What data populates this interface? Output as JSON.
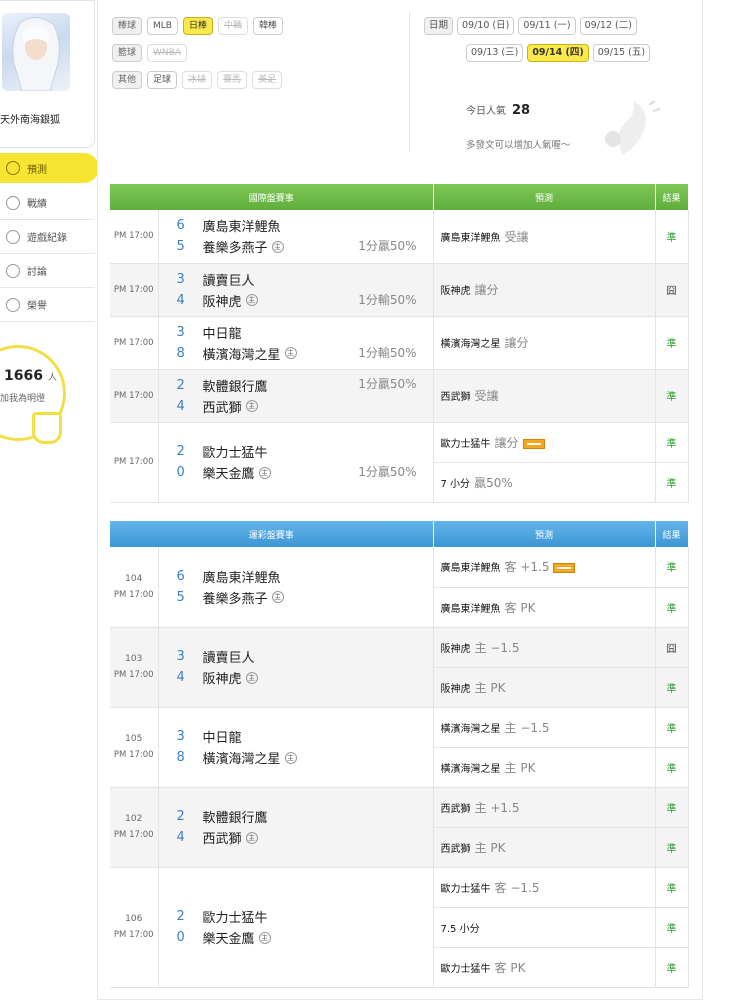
{
  "user": {
    "name": "天外南海銀狐"
  },
  "nav": [
    {
      "label": "預測",
      "icon": "target-icon",
      "active": true
    },
    {
      "label": "戰績",
      "icon": "chat-icon",
      "active": false
    },
    {
      "label": "遊戲紀錄",
      "icon": "circle-icon",
      "active": false
    },
    {
      "label": "討論",
      "icon": "edit-icon",
      "active": false
    },
    {
      "label": "榮譽",
      "icon": "medal-icon",
      "active": false
    }
  ],
  "bulb": {
    "count": "1666",
    "unit": "人",
    "text": "加我為明燈"
  },
  "filters": {
    "baseball": {
      "label": "棒球",
      "items": [
        "MLB",
        "日棒",
        "中職",
        "韓棒"
      ]
    },
    "basketball": {
      "label": "籃球",
      "items": [
        "WNBA"
      ]
    },
    "other": {
      "label": "其他",
      "items": [
        "足球",
        "冰球",
        "賽馬",
        "美足"
      ]
    }
  },
  "dates": {
    "label": "日期",
    "row1": [
      "09/10 (日)",
      "09/11 (一)",
      "09/12 (二)"
    ],
    "row2": [
      "09/13 (三)",
      "09/14 (四)",
      "09/15 (五)"
    ]
  },
  "popularity": {
    "label": "今日人氣",
    "value": "28",
    "note": "多發文可以增加人氣喔～"
  },
  "intl": {
    "headers": [
      "國際盤賽事",
      "預測",
      "結果"
    ],
    "games": [
      {
        "time": "PM 17:00",
        "s1": "6",
        "t1": "廣島東洋鯉魚",
        "s2": "5",
        "t2": "養樂多燕子",
        "home": "主",
        "odds": "1分贏50%",
        "preds": [
          {
            "team": "廣島東洋鯉魚",
            "sub": "受讓",
            "result": "準"
          }
        ]
      },
      {
        "time": "PM 17:00",
        "s1": "3",
        "t1": "讀賣巨人",
        "s2": "4",
        "t2": "阪神虎",
        "home": "主",
        "odds": "1分輸50%",
        "preds": [
          {
            "team": "阪神虎",
            "sub": "讓分",
            "result": "囧"
          }
        ]
      },
      {
        "time": "PM 17:00",
        "s1": "3",
        "t1": "中日龍",
        "s2": "8",
        "t2": "橫濱海灣之星",
        "home": "主",
        "odds": "1分輸50%",
        "preds": [
          {
            "team": "橫濱海灣之星",
            "sub": "讓分",
            "result": "準"
          }
        ]
      },
      {
        "time": "PM 17:00",
        "s1": "2",
        "t1": "軟體銀行鷹",
        "s2": "4",
        "t2": "西武獅",
        "home": "主",
        "odds": "1分贏50%",
        "preds": [
          {
            "team": "西武獅",
            "sub": "受讓",
            "result": "準"
          }
        ]
      },
      {
        "time": "PM 17:00",
        "s1": "2",
        "t1": "歐力士猛牛",
        "s2": "0",
        "t2": "樂天金鷹",
        "home": "主",
        "odds": "1分贏50%",
        "preds": [
          {
            "team": "歐力士猛牛",
            "sub": "讓分",
            "result": "準"
          },
          {
            "team": "7 小分",
            "sub": "贏50%",
            "result": "準"
          }
        ]
      }
    ]
  },
  "lottery": {
    "headers": [
      "運彩盤賽事",
      "預測",
      "結果"
    ],
    "games": [
      {
        "num": "104",
        "time": "PM 17:00",
        "s1": "6",
        "t1": "廣島東洋鯉魚",
        "s2": "5",
        "t2": "養樂多燕子",
        "home": "主",
        "preds": [
          {
            "team": "廣島東洋鯉魚",
            "sub": "客 +1.5",
            "result": "準"
          },
          {
            "team": "廣島東洋鯉魚",
            "sub": "客 PK",
            "result": "準"
          }
        ]
      },
      {
        "num": "103",
        "time": "PM 17:00",
        "s1": "3",
        "t1": "讀賣巨人",
        "s2": "4",
        "t2": "阪神虎",
        "home": "主",
        "preds": [
          {
            "team": "阪神虎",
            "sub": "主 −1.5",
            "result": "囧"
          },
          {
            "team": "阪神虎",
            "sub": "主 PK",
            "result": "準"
          }
        ]
      },
      {
        "num": "105",
        "time": "PM 17:00",
        "s1": "3",
        "t1": "中日龍",
        "s2": "8",
        "t2": "橫濱海灣之星",
        "home": "主",
        "preds": [
          {
            "team": "橫濱海灣之星",
            "sub": "主 −1.5",
            "result": "準"
          },
          {
            "team": "橫濱海灣之星",
            "sub": "主 PK",
            "result": "準"
          }
        ]
      },
      {
        "num": "102",
        "time": "PM 17:00",
        "s1": "2",
        "t1": "軟體銀行鷹",
        "s2": "4",
        "t2": "西武獅",
        "home": "主",
        "preds": [
          {
            "team": "西武獅",
            "sub": "主 +1.5",
            "result": "準"
          },
          {
            "team": "西武獅",
            "sub": "主 PK",
            "result": "準"
          }
        ]
      },
      {
        "num": "106",
        "time": "PM 17:00",
        "s1": "2",
        "t1": "歐力士猛牛",
        "s2": "0",
        "t2": "樂天金鷹",
        "home": "主",
        "preds": [
          {
            "team": "歐力士猛牛",
            "sub": "客 −1.5",
            "result": "準"
          },
          {
            "team": "7.5 小分",
            "sub": "",
            "result": "準"
          },
          {
            "team": "歐力士猛牛",
            "sub": "客 PK",
            "result": "準"
          }
        ]
      }
    ]
  }
}
